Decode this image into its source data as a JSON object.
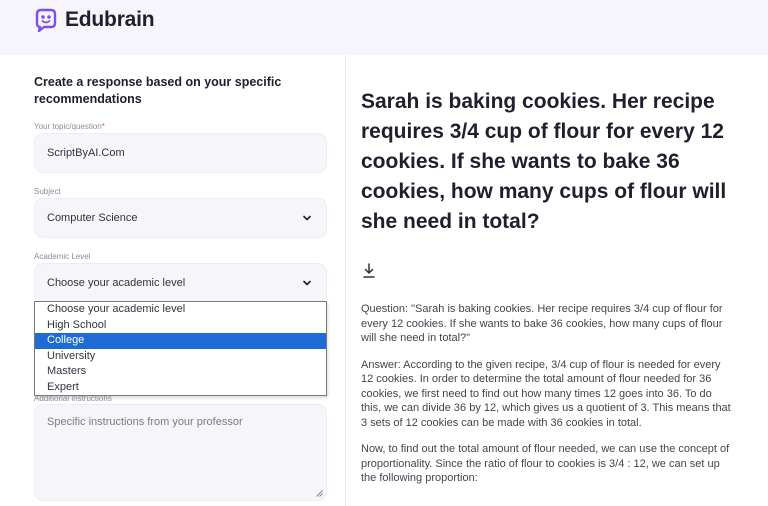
{
  "brand": {
    "name": "Edubrain"
  },
  "form": {
    "heading": "Create a response based on your specific recommendations",
    "topic": {
      "label": "Your topic/question",
      "required_mark": "*",
      "value": "ScriptByAI.Com"
    },
    "subject": {
      "label": "Subject",
      "value": "Computer Science"
    },
    "academic_level": {
      "label": "Academic Level",
      "value": "Choose your academic level",
      "options": [
        "Choose your academic level",
        "High School",
        "College",
        "University",
        "Masters",
        "Expert"
      ],
      "highlighted": "College"
    },
    "additional": {
      "label": "Additional instructions",
      "placeholder": "Specific instructions from your professor"
    }
  },
  "result": {
    "question": "Sarah is baking cookies. Her recipe requires 3/4 cup of flour for every 12 cookies. If she wants to bake 36 cookies, how many cups of flour will she need in total?",
    "paragraphs": [
      "Question: \"Sarah is baking cookies. Her recipe requires 3/4 cup of flour for every 12 cookies. If she wants to bake 36 cookies, how many cups of flour will she need in total?\"",
      "Answer: According to the given recipe, 3/4 cup of flour is needed for every 12 cookies. In order to determine the total amount of flour needed for 36 cookies, we first need to find out how many times 12 goes into 36. To do this, we can divide 36 by 12, which gives us a quotient of 3. This means that 3 sets of 12 cookies can be made with 36 cookies in total.",
      "Now, to find out the total amount of flour needed, we can use the concept of proportionality. Since the ratio of flour to cookies is 3/4 : 12, we can set up the following proportion:"
    ]
  },
  "colors": {
    "brand": "#7b4ff2",
    "highlight": "#1f6bd6"
  }
}
